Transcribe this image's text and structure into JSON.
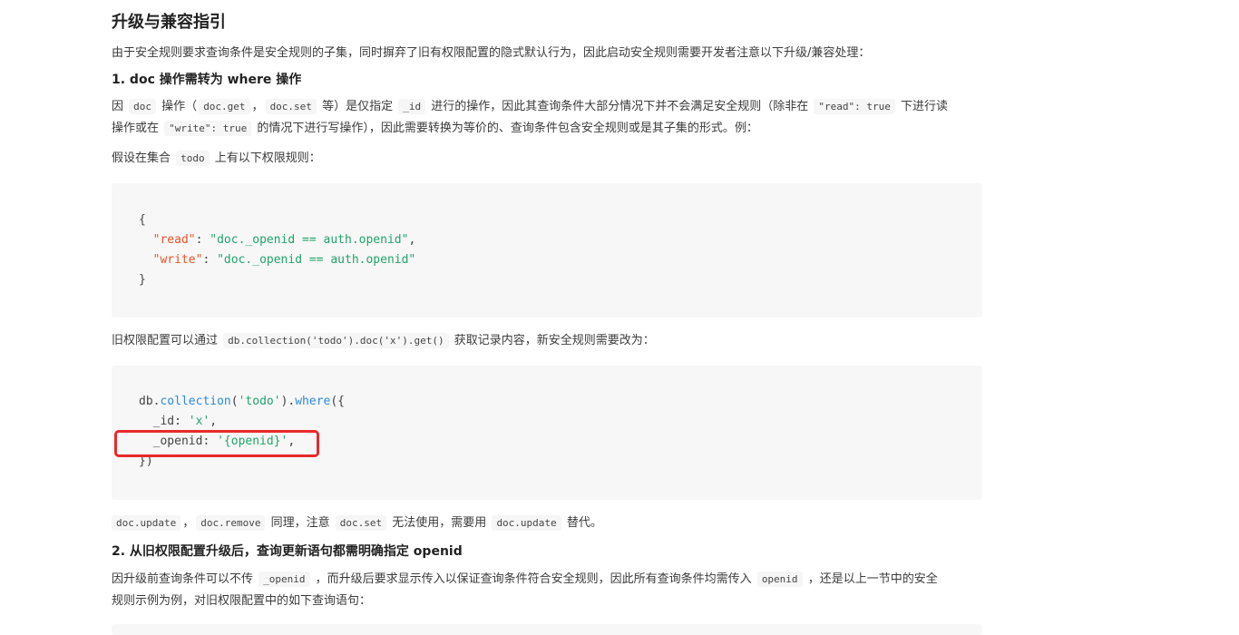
{
  "heading": "升级与兼容指引",
  "intro": "由于安全规则要求查询条件是安全规则的子集，同时摒弃了旧有权限配置的隐式默认行为，因此启动安全规则需要开发者注意以下升级/兼容处理：",
  "section1": {
    "title": "1. doc 操作需转为 where 操作",
    "p1_a": "因",
    "p1_code1": "doc",
    "p1_b": "操作（",
    "p1_code2": "doc.get",
    "p1_c": "，",
    "p1_code3": "doc.set",
    "p1_d": "等）是仅指定",
    "p1_code4": "_id",
    "p1_e": "进行的操作，因此其查询条件大部分情况下并不会满足安全规则（除非在",
    "p1_code5": "\"read\": true",
    "p1_f": "下进行读",
    "p1_g": "操作或在",
    "p1_code6": "\"write\": true",
    "p1_h": "的情况下进行写操作），因此需要转换为等价的、查询条件包含安全规则或是其子集的形式。例：",
    "p2_a": "假设在集合",
    "p2_code": "todo",
    "p2_b": "上有以下权限规则：",
    "code1": {
      "l1": "{",
      "l2_key": "\"read\"",
      "l2_sep": ": ",
      "l2_val": "\"doc._openid == auth.openid\"",
      "l2_end": ",",
      "l3_key": "\"write\"",
      "l3_sep": ": ",
      "l3_val": "\"doc._openid == auth.openid\"",
      "l4": "}"
    },
    "p3_a": "旧权限配置可以通过",
    "p3_code": "db.collection('todo').doc('x').get()",
    "p3_b": "获取记录内容，新安全规则需要改为：",
    "code2": {
      "l1_a": "db.",
      "l1_fn": "collection",
      "l1_b": "(",
      "l1_str": "'todo'",
      "l1_c": ").",
      "l1_fn2": "where",
      "l1_d": "({",
      "l2_a": "  _id: ",
      "l2_str": "'x'",
      "l2_b": ",",
      "l3_a": "  _openid: ",
      "l3_str": "'{openid}'",
      "l3_b": ",",
      "l4": "})"
    },
    "p4_code1": "doc.update",
    "p4_a": "，",
    "p4_code2": "doc.remove",
    "p4_b": "同理，注意",
    "p4_code3": "doc.set",
    "p4_c": "无法使用，需要用",
    "p4_code4": "doc.update",
    "p4_d": "替代。"
  },
  "section2": {
    "title": "2. 从旧权限配置升级后，查询更新语句都需明确指定 openid",
    "p1_a": "因升级前查询条件可以不传",
    "p1_code1": "_openid",
    "p1_b": "，而升级后要求显示传入以保证查询条件符合安全规则，因此所有查询条件均需传入",
    "p1_code2": "openid",
    "p1_c": "，还是以上一节中的安全",
    "p1_d": "规则示例为例，对旧权限配置中的如下查询语句："
  },
  "colors": {
    "string": "#22a36a",
    "key": "#e8542a",
    "function": "#2e8bd8",
    "highlight": "#e82a2a"
  }
}
